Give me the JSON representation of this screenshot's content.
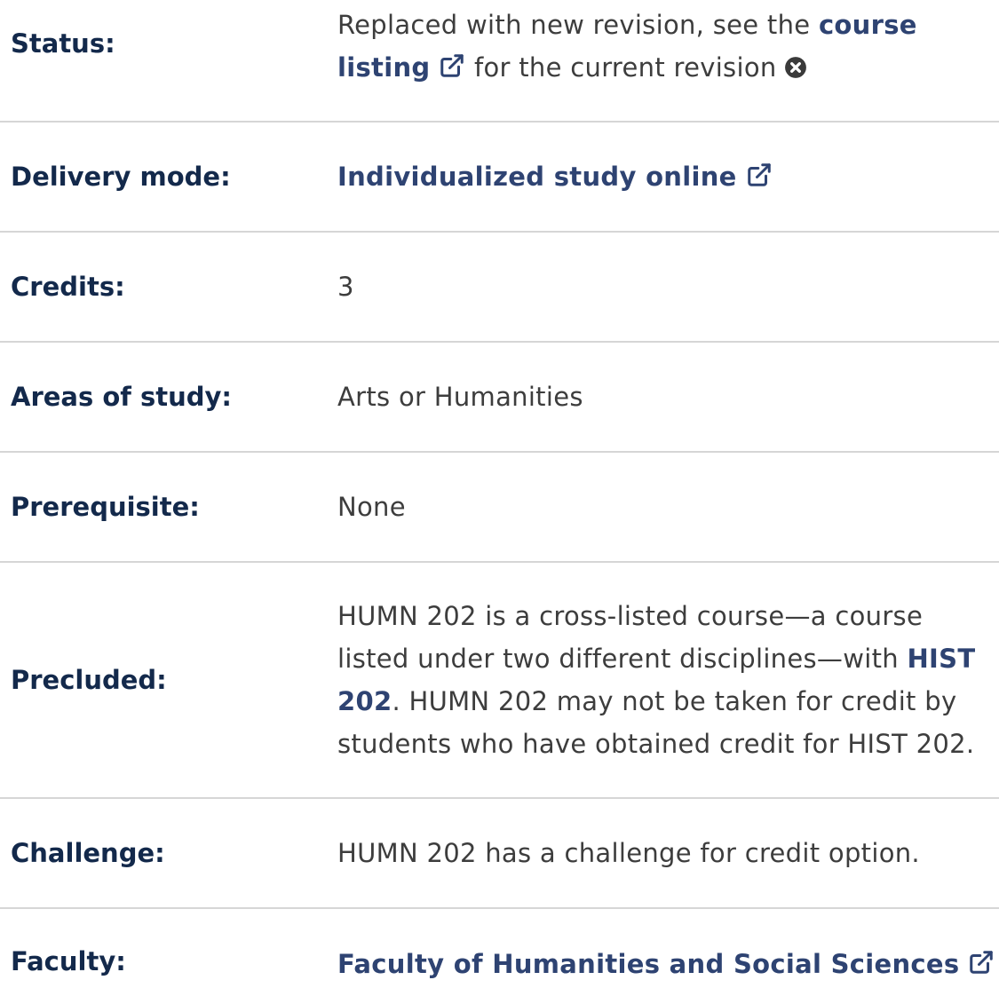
{
  "rows": {
    "status": {
      "label": "Status:",
      "text_before": "Replaced with new revision, see the ",
      "link": "course listing",
      "text_after": " for the current revision"
    },
    "delivery": {
      "label": "Delivery mode:",
      "link": "Individualized study online"
    },
    "credits": {
      "label": "Credits:",
      "value": "3"
    },
    "areas": {
      "label": "Areas of study:",
      "value": "Arts or Humanities"
    },
    "prerequisite": {
      "label": "Prerequisite:",
      "value": "None"
    },
    "precluded": {
      "label": "Precluded:",
      "text_before": "HUMN 202 is a cross-listed course—a course listed under two different disciplines—with ",
      "link": "HIST 202",
      "text_after": ". HUMN 202 may not be taken for credit by students who have obtained credit for HIST 202."
    },
    "challenge": {
      "label": "Challenge:",
      "value": "HUMN 202 has a challenge for credit option."
    },
    "faculty": {
      "label": "Faculty:",
      "link": "Faculty of Humanities and Social Sciences"
    }
  },
  "icons": {
    "external_link": "external-link-icon",
    "close": "close-circle-icon"
  },
  "colors": {
    "label": "#13294b",
    "link": "#2e4372",
    "text": "#3d3d3d",
    "divider": "#d6d6d6"
  }
}
